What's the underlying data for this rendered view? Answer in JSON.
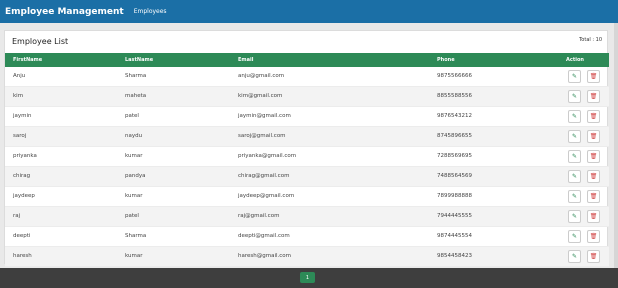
{
  "app": {
    "title": "Employee Management",
    "nav_link": "Employees"
  },
  "card": {
    "title": "Employee List",
    "total": "Total : 10"
  },
  "table": {
    "headers": [
      "FirstName",
      "LastName",
      "Email",
      "Phone",
      "Action"
    ],
    "rows": [
      [
        "Anju",
        "Sharma",
        "anju@gmail.com",
        "9875566666"
      ],
      [
        "kim",
        "maheta",
        "kim@gmail.com",
        "8855588556"
      ],
      [
        "jaymin",
        "patel",
        "jaymin@gmail.com",
        "9876543212"
      ],
      [
        "saroj",
        "naydu",
        "saroj@gmail.com",
        "8745896655"
      ],
      [
        "priyanka",
        "kumar",
        "priyanka@gmail.com",
        "7288569695"
      ],
      [
        "chirag",
        "pandya",
        "chirag@gmail.com",
        "7488564569"
      ],
      [
        "jaydeep",
        "kumar",
        "jaydeep@gmail.com",
        "7899988888"
      ],
      [
        "raj",
        "patel",
        "raj@gmail.com",
        "7944445555"
      ],
      [
        "deepti",
        "Sharma",
        "deepti@gmail.com",
        "9874445554"
      ],
      [
        "haresh",
        "kumar",
        "haresh@gmail.com",
        "9854458423"
      ]
    ]
  },
  "icons": {
    "edit": "pencil-icon",
    "delete": "trash-icon"
  },
  "pagination": {
    "current": "1"
  },
  "colors": {
    "navbar": "#1b6fa6",
    "header": "#2d8a57",
    "delete": "#d04040"
  }
}
